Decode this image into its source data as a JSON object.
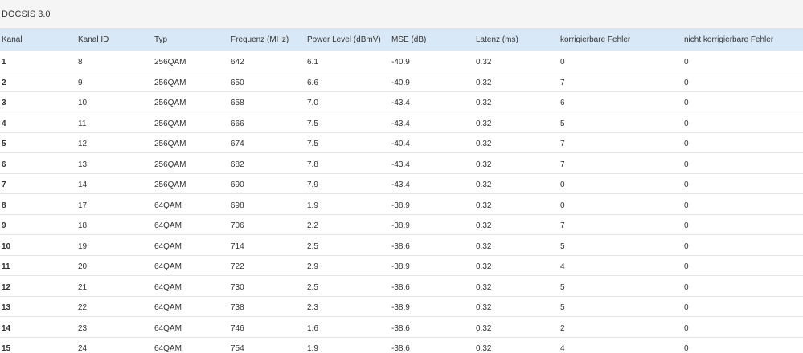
{
  "panel": {
    "title": "DOCSIS 3.0"
  },
  "table": {
    "headers": [
      "Kanal",
      "Kanal ID",
      "Typ",
      "Frequenz (MHz)",
      "Power Level (dBmV)",
      "MSE (dB)",
      "Latenz (ms)",
      "korrigierbare Fehler",
      "nicht korrigierbare Fehler"
    ],
    "rows": [
      [
        "1",
        "8",
        "256QAM",
        "642",
        "6.1",
        "-40.9",
        "0.32",
        "0",
        "0"
      ],
      [
        "2",
        "9",
        "256QAM",
        "650",
        "6.6",
        "-40.9",
        "0.32",
        "7",
        "0"
      ],
      [
        "3",
        "10",
        "256QAM",
        "658",
        "7.0",
        "-43.4",
        "0.32",
        "6",
        "0"
      ],
      [
        "4",
        "11",
        "256QAM",
        "666",
        "7.5",
        "-43.4",
        "0.32",
        "5",
        "0"
      ],
      [
        "5",
        "12",
        "256QAM",
        "674",
        "7.5",
        "-40.4",
        "0.32",
        "7",
        "0"
      ],
      [
        "6",
        "13",
        "256QAM",
        "682",
        "7.8",
        "-43.4",
        "0.32",
        "7",
        "0"
      ],
      [
        "7",
        "14",
        "256QAM",
        "690",
        "7.9",
        "-43.4",
        "0.32",
        "0",
        "0"
      ],
      [
        "8",
        "17",
        "64QAM",
        "698",
        "1.9",
        "-38.9",
        "0.32",
        "0",
        "0"
      ],
      [
        "9",
        "18",
        "64QAM",
        "706",
        "2.2",
        "-38.9",
        "0.32",
        "7",
        "0"
      ],
      [
        "10",
        "19",
        "64QAM",
        "714",
        "2.5",
        "-38.6",
        "0.32",
        "5",
        "0"
      ],
      [
        "11",
        "20",
        "64QAM",
        "722",
        "2.9",
        "-38.9",
        "0.32",
        "4",
        "0"
      ],
      [
        "12",
        "21",
        "64QAM",
        "730",
        "2.5",
        "-38.6",
        "0.32",
        "5",
        "0"
      ],
      [
        "13",
        "22",
        "64QAM",
        "738",
        "2.3",
        "-38.9",
        "0.32",
        "5",
        "0"
      ],
      [
        "14",
        "23",
        "64QAM",
        "746",
        "1.6",
        "-38.6",
        "0.32",
        "2",
        "0"
      ],
      [
        "15",
        "24",
        "64QAM",
        "754",
        "1.9",
        "-38.6",
        "0.32",
        "4",
        "0"
      ]
    ]
  }
}
